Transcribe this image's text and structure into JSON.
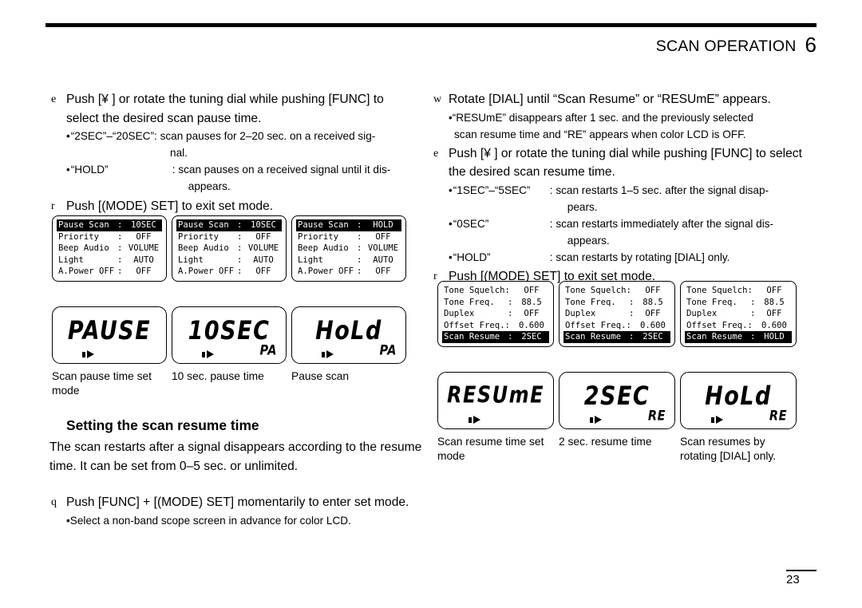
{
  "header": {
    "title": "SCAN OPERATION",
    "chapter": "6"
  },
  "left_column": {
    "step_e": {
      "marker": "e",
      "text": "Push [¥ ] or rotate the tuning dial while pushing [FUNC] to select the desired scan pause time.",
      "bullets": [
        {
          "bullet": "•",
          "term": "“2SEC”–“20SEC”",
          "desc": ": scan pauses for 2–20 sec. on a received sig-",
          "cont": "nal."
        },
        {
          "bullet": "•",
          "term": "“HOLD”",
          "desc": ": scan pauses on a received signal until it dis-",
          "cont": "appears."
        }
      ]
    },
    "step_r": {
      "marker": "r",
      "text": "Push [(MODE) SET] to exit set mode."
    },
    "section": {
      "heading": "Setting the scan resume time",
      "paragraph": "The scan restarts after a signal disappears according to the resume time. It can be set from 0–5 sec. or unlimited."
    },
    "step_q": {
      "marker": "q",
      "text": "Push [FUNC] + [(MODE) SET] momentarily to enter set mode.",
      "bullet": "•Select a non-band scope screen in advance for color LCD."
    }
  },
  "right_column": {
    "step_w": {
      "marker": "w",
      "text": "Rotate [DIAL] until “Scan Resume” or “RESUmE” appears.",
      "bullet_line1": "•“RESUmE” disappears after 1 sec. and the previously selected",
      "bullet_line2": "scan resume time and “RE” appears when color LCD is OFF."
    },
    "step_e": {
      "marker": "e",
      "text": "Push [¥ ] or rotate the tuning dial while pushing [FUNC] to select the desired scan resume time.",
      "bullets": [
        {
          "bullet": "•",
          "term": "“1SEC”–“5SEC”",
          "desc": ": scan restarts 1–5 sec. after the signal disap-",
          "cont": "pears."
        },
        {
          "bullet": "•",
          "term": "“0SEC”",
          "desc": ": scan restarts immediately after the signal dis-",
          "cont": "appears."
        },
        {
          "bullet": "•",
          "term": "“HOLD”",
          "desc": ": scan restarts by rotating [DIAL] only.",
          "cont": ""
        }
      ]
    },
    "step_r": {
      "marker": "r",
      "text": "Push [(MODE) SET] to exit set mode."
    }
  },
  "figures": {
    "pause_menus": [
      {
        "rows": [
          {
            "label": "Pause Scan",
            "colon": ":",
            "value": "10SEC",
            "inverted": true
          },
          {
            "label": "Priority",
            "colon": ":",
            "value": "OFF",
            "inverted": false
          },
          {
            "label": "Beep Audio",
            "colon": ":",
            "value": "VOLUME",
            "inverted": false
          },
          {
            "label": "Light",
            "colon": ":",
            "value": "AUTO",
            "inverted": false
          },
          {
            "label": "A.Power OFF",
            "colon": ":",
            "value": "OFF",
            "inverted": false
          }
        ]
      },
      {
        "rows": [
          {
            "label": "Pause Scan",
            "colon": ":",
            "value": "10SEC",
            "inverted": true
          },
          {
            "label": "Priority",
            "colon": ":",
            "value": "OFF",
            "inverted": false
          },
          {
            "label": "Beep Audio",
            "colon": ":",
            "value": "VOLUME",
            "inverted": false
          },
          {
            "label": "Light",
            "colon": ":",
            "value": "AUTO",
            "inverted": false
          },
          {
            "label": "A.Power OFF",
            "colon": ":",
            "value": "OFF",
            "inverted": false
          }
        ]
      },
      {
        "rows": [
          {
            "label": "Pause Scan",
            "colon": ":",
            "value": "HOLD",
            "inverted": true
          },
          {
            "label": "Priority",
            "colon": ":",
            "value": "OFF",
            "inverted": false
          },
          {
            "label": "Beep Audio",
            "colon": ":",
            "value": "VOLUME",
            "inverted": false
          },
          {
            "label": "Light",
            "colon": ":",
            "value": "AUTO",
            "inverted": false
          },
          {
            "label": "A.Power OFF",
            "colon": ":",
            "value": "OFF",
            "inverted": false
          }
        ]
      }
    ],
    "pause_segments": [
      {
        "main": "PAUSE",
        "suffix": "",
        "caption": "Scan pause time set mode"
      },
      {
        "main": "10SEC",
        "suffix": "PA",
        "caption": "10 sec. pause time"
      },
      {
        "main": "HoLd",
        "suffix": "PA",
        "caption": "Pause scan"
      }
    ],
    "resume_menus": [
      {
        "rows": [
          {
            "label": "Tone Squelch:",
            "colon": "",
            "value": "OFF",
            "inverted": false
          },
          {
            "label": "Tone Freq.",
            "colon": ":",
            "value": "88.5",
            "inverted": false
          },
          {
            "label": "Duplex",
            "colon": ":",
            "value": "OFF",
            "inverted": false
          },
          {
            "label": "Offset Freq.:",
            "colon": "",
            "value": "0.600",
            "inverted": false
          },
          {
            "label": "Scan Resume",
            "colon": ":",
            "value": "2SEC",
            "inverted": true
          }
        ]
      },
      {
        "rows": [
          {
            "label": "Tone Squelch:",
            "colon": "",
            "value": "OFF",
            "inverted": false
          },
          {
            "label": "Tone Freq.",
            "colon": ":",
            "value": "88.5",
            "inverted": false
          },
          {
            "label": "Duplex",
            "colon": ":",
            "value": "OFF",
            "inverted": false
          },
          {
            "label": "Offset Freq.:",
            "colon": "",
            "value": "0.600",
            "inverted": false
          },
          {
            "label": "Scan Resume",
            "colon": ":",
            "value": "2SEC",
            "inverted": true
          }
        ]
      },
      {
        "rows": [
          {
            "label": "Tone Squelch:",
            "colon": "",
            "value": "OFF",
            "inverted": false
          },
          {
            "label": "Tone Freq.",
            "colon": ":",
            "value": "88.5",
            "inverted": false
          },
          {
            "label": "Duplex",
            "colon": ":",
            "value": "OFF",
            "inverted": false
          },
          {
            "label": "Offset Freq.:",
            "colon": "",
            "value": "0.600",
            "inverted": false
          },
          {
            "label": "Scan Resume",
            "colon": ":",
            "value": "HOLD",
            "inverted": true
          }
        ]
      }
    ],
    "resume_segments": [
      {
        "main": "RESUmE",
        "suffix": "",
        "caption": "Scan resume time set mode"
      },
      {
        "main": "2SEC",
        "suffix": "RE",
        "caption": "2 sec. resume time"
      },
      {
        "main": "HoLd",
        "suffix": "RE",
        "caption": "Scan resumes by rotating [DIAL] only."
      }
    ]
  },
  "footer": {
    "page_number": "23"
  }
}
